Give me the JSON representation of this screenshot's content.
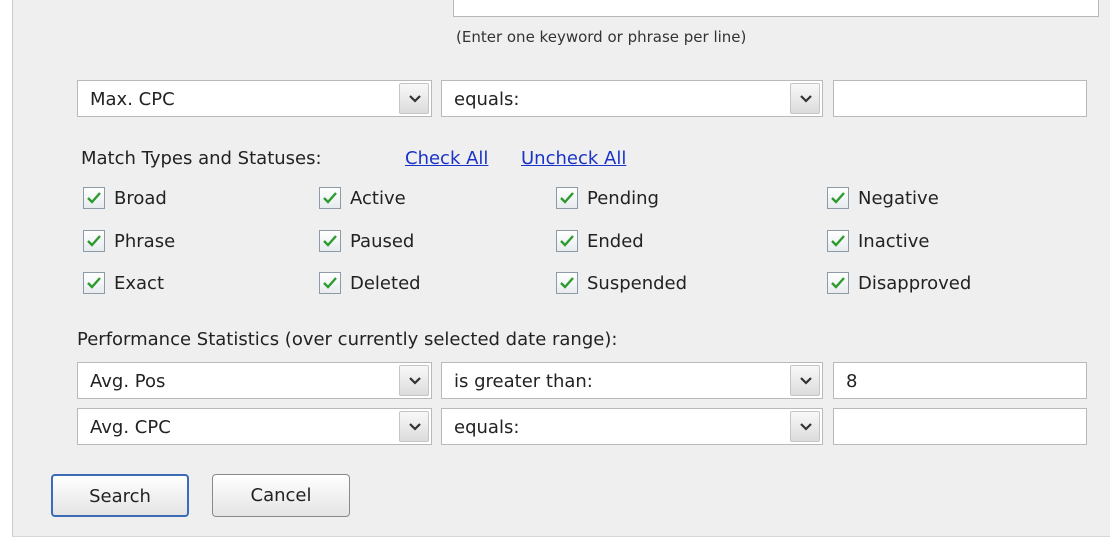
{
  "keyword_hint": "(Enter one keyword or phrase per line)",
  "filter_row": {
    "field": "Max. CPC",
    "operator": "equals:",
    "value": ""
  },
  "match_section": {
    "label": "Match Types and Statuses:",
    "check_all": "Check All",
    "uncheck_all": "Uncheck All",
    "checkboxes": [
      {
        "label": "Broad",
        "checked": true
      },
      {
        "label": "Phrase",
        "checked": true
      },
      {
        "label": "Exact",
        "checked": true
      },
      {
        "label": "Active",
        "checked": true
      },
      {
        "label": "Paused",
        "checked": true
      },
      {
        "label": "Deleted",
        "checked": true
      },
      {
        "label": "Pending",
        "checked": true
      },
      {
        "label": "Ended",
        "checked": true
      },
      {
        "label": "Suspended",
        "checked": true
      },
      {
        "label": "Negative",
        "checked": true
      },
      {
        "label": "Inactive",
        "checked": true
      },
      {
        "label": "Disapproved",
        "checked": true
      }
    ]
  },
  "performance": {
    "label": "Performance Statistics (over currently selected date range):",
    "rows": [
      {
        "field": "Avg. Pos",
        "operator": "is greater than:",
        "value": "8"
      },
      {
        "field": "Avg. CPC",
        "operator": "equals:",
        "value": ""
      }
    ]
  },
  "buttons": {
    "search": "Search",
    "cancel": "Cancel"
  },
  "colors": {
    "link": "#1a33c7",
    "checkmark": "#2e9b2e",
    "panel_bg": "#efefef",
    "primary_border": "#3d6bb5"
  }
}
